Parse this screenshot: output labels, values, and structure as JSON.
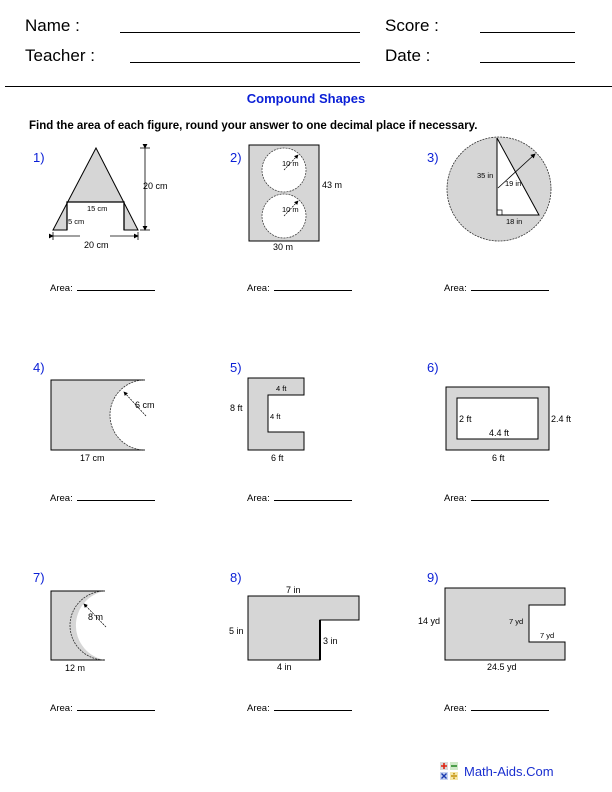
{
  "header": {
    "name_label": "Name :",
    "teacher_label": "Teacher :",
    "score_label": "Score :",
    "date_label": "Date :"
  },
  "title": "Compound Shapes",
  "instructions": "Find the area of each figure, round your answer to one decimal place if necessary.",
  "area_label": "Area:",
  "colors": {
    "title_blue": "#0a1fd6",
    "shape_fill": "#d6d6d6"
  },
  "problems": [
    {
      "number": "1)",
      "labels": {
        "height": "20 cm",
        "top_cut": "15 cm",
        "side_cut": "5 cm",
        "base": "20 cm"
      }
    },
    {
      "number": "2)",
      "labels": {
        "radius_top": "10 m",
        "radius_bottom": "10 m",
        "height": "43 m",
        "width": "30 m"
      }
    },
    {
      "number": "3)",
      "labels": {
        "height": "35 in",
        "radius": "19 in",
        "base": "18 in"
      }
    },
    {
      "number": "4)",
      "labels": {
        "radius": "6 cm",
        "length": "17 cm"
      }
    },
    {
      "number": "5)",
      "labels": {
        "notch_top": "4 ft",
        "notch_height": "4 ft",
        "height": "8 ft",
        "width": "6 ft"
      }
    },
    {
      "number": "6)",
      "labels": {
        "inner_height": "2 ft",
        "inner_width": "4.4 ft",
        "outer_height": "2.4 ft",
        "outer_width": "6 ft"
      }
    },
    {
      "number": "7)",
      "labels": {
        "radius": "8 m",
        "length": "12 m"
      }
    },
    {
      "number": "8)",
      "labels": {
        "top": "7 in",
        "left": "5 in",
        "step": "3 in",
        "bottom": "4 in"
      }
    },
    {
      "number": "9)",
      "labels": {
        "left": "14 yd",
        "notch_height": "7 yd",
        "notch_width": "7 yd",
        "bottom": "24.5 yd"
      }
    }
  ],
  "footer": {
    "brand": "Math-Aids.Com"
  }
}
